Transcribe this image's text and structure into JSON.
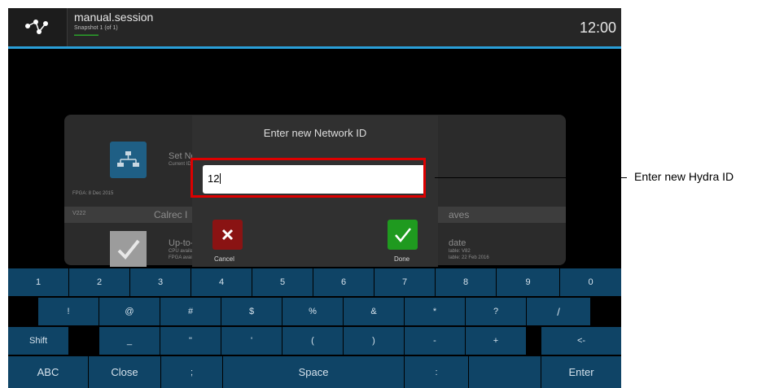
{
  "header": {
    "session_name": "manual.session",
    "snapshot": "Snapshot 1 (of 1)",
    "time": "12:00"
  },
  "background": {
    "set_network_label": "Set Netv",
    "current_id_label": "Current ID:",
    "fpga_date": "FPGA: 8 Dec 2015",
    "version": "V222",
    "device_label": "Calrec I",
    "right_label": "aves",
    "up_to_date_label": "Up-to-da",
    "cpu_available": "CPU availat",
    "fpga_available": "FPGA availa",
    "update_label": "date",
    "update_line1": "lable: V82",
    "update_line2": "lable: 22 Feb 2016"
  },
  "dialog": {
    "title": "Enter new Network ID",
    "input_value": "12",
    "cancel_label": "Cancel",
    "done_label": "Done",
    "cancel_icon": "close-icon",
    "done_icon": "check-icon"
  },
  "keyboard": {
    "row1": [
      "1",
      "2",
      "3",
      "4",
      "5",
      "6",
      "7",
      "8",
      "9",
      "0"
    ],
    "row2": [
      "!",
      "@",
      "#",
      "$",
      "%",
      "&",
      "*",
      "?",
      "/"
    ],
    "row3": [
      "Shift",
      "_",
      "\"",
      "'",
      "(",
      ")",
      "-",
      "+",
      "<-"
    ],
    "row4": [
      "ABC",
      "Close",
      ";",
      "Space",
      ":",
      "Enter"
    ]
  },
  "annotation": {
    "callout": "Enter new Hydra ID"
  },
  "colors": {
    "accent": "#2a9fd8",
    "key_bg": "#0f4466",
    "cancel": "#8a1313",
    "done": "#1f9a1f",
    "highlight": "#dd0000"
  }
}
